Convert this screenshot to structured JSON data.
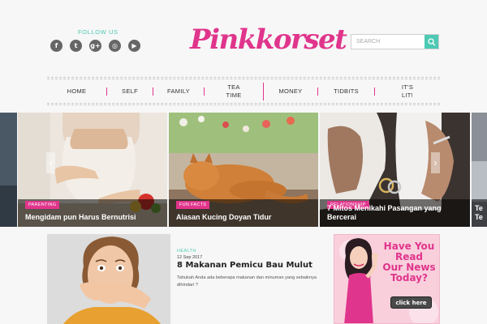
{
  "header": {
    "follow_label": "FOLLOW US",
    "social": [
      {
        "glyph": "f",
        "icon": "facebook-icon"
      },
      {
        "glyph": "t",
        "icon": "twitter-icon"
      },
      {
        "glyph": "g+",
        "icon": "google-plus-icon"
      },
      {
        "glyph": "◎",
        "icon": "instagram-icon"
      },
      {
        "glyph": "▶",
        "icon": "youtube-icon"
      }
    ],
    "logo": "Pinkkorset",
    "search_placeholder": "SEARCH"
  },
  "nav": {
    "home": "HOME",
    "self": "SELF",
    "family": "FAMILY",
    "tea_time_1": "TEA",
    "tea_time_2": "TIME",
    "money": "MONEY",
    "tidbits": "TIDBITS",
    "its_lit_1": "IT'S",
    "its_lit_2": "LIT!"
  },
  "slider": {
    "slides": [
      {
        "category": "PARENTING",
        "title": "Mengidam pun Harus Bernutrisi"
      },
      {
        "category": "FUN FACTS",
        "title": "Alasan Kucing Doyan Tidur"
      },
      {
        "category": "RELATIONSHIP",
        "title_line1": "7 Mitos Menikahi Pasangan yang",
        "title_line2": "Bercerai"
      },
      {
        "title_line1": "Te",
        "title_line2": "Te"
      }
    ],
    "prev_arrow": "‹",
    "next_arrow": "›"
  },
  "article": {
    "category": "HEALTH",
    "date": "12 Sep 2017",
    "title": "8 Makanan Pemicu Bau Mulut",
    "excerpt": "Tahukah Anda ada beberapa makanan dan minuman yang sebaiknya dihindari ?"
  },
  "ad": {
    "line1": "Have You",
    "line2": "Read",
    "line3": "Our News",
    "line4": "Today?",
    "button": "click here"
  },
  "colors": {
    "brand_pink": "#e0358c",
    "accent_teal": "#4dc9b4",
    "background": "#f7f7f7"
  }
}
